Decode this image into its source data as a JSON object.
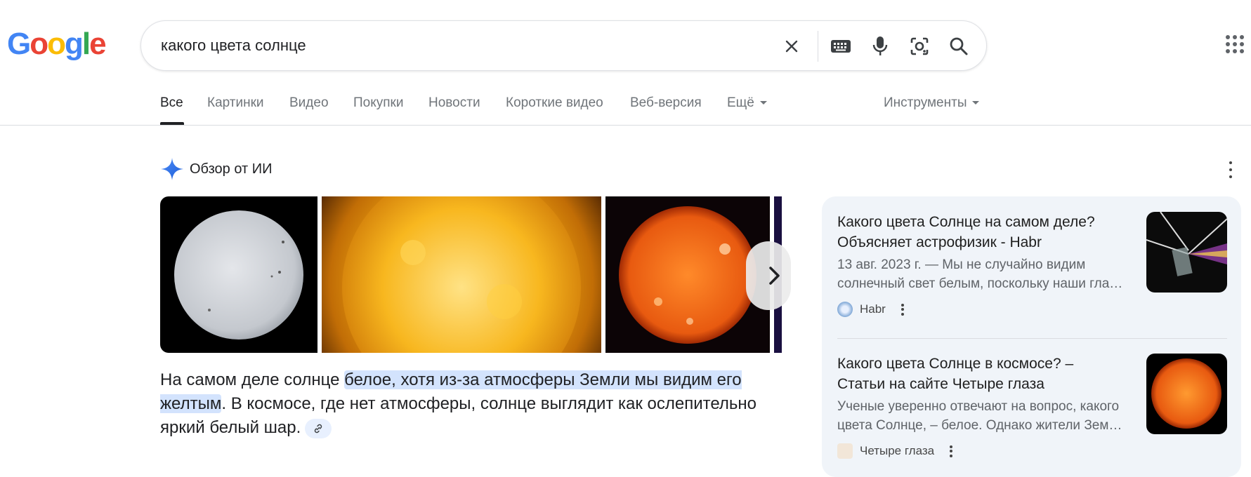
{
  "logo": {
    "text": [
      "G",
      "o",
      "o",
      "g",
      "l",
      "e"
    ]
  },
  "search": {
    "query": "какого цвета солнце"
  },
  "icons": {
    "clear": "close-icon",
    "keyboard": "keyboard-icon",
    "voice": "microphone-icon",
    "lens": "camera-lens-icon",
    "search": "search-icon",
    "apps": "apps-grid-icon"
  },
  "tabs": [
    {
      "label": "Все",
      "active": true
    },
    {
      "label": "Картинки"
    },
    {
      "label": "Видео"
    },
    {
      "label": "Покупки"
    },
    {
      "label": "Новости"
    },
    {
      "label": "Короткие видео"
    },
    {
      "label": "Веб-версия"
    },
    {
      "label": "Ещё"
    }
  ],
  "tools_label": "Инструменты",
  "ai_overview": {
    "title": "Обзор от ИИ",
    "answer_prefix": "На самом деле солнце ",
    "answer_highlight": "белое, хотя из-за атмосферы Земли мы видим его желтым",
    "answer_suffix": ". В космосе, где нет атмосферы, солнце выглядит как ослепительно яркий белый шар."
  },
  "sources": [
    {
      "title": "Какого цвета Солнце на самом деле? Объясняет астрофизик - Habr",
      "snippet_line1": "13 авг. 2023 г. — Мы не случайно видим",
      "snippet_line2": "солнечный свет белым, поскольку наши гла…",
      "source": "Habr"
    },
    {
      "title": "Какого цвета Солнце в космосе? – Статьи на сайте Четыре глаза",
      "snippet_line1": "Ученые уверенно отвечают на вопрос, какого",
      "snippet_line2": "цвета Солнце, – белое. Однако жители Зем…",
      "source": "Четыре глаза"
    }
  ],
  "colors": {
    "accent_blue": "#4285f4",
    "highlight": "#d3e3fd",
    "panel_bg": "#f0f4f9"
  }
}
